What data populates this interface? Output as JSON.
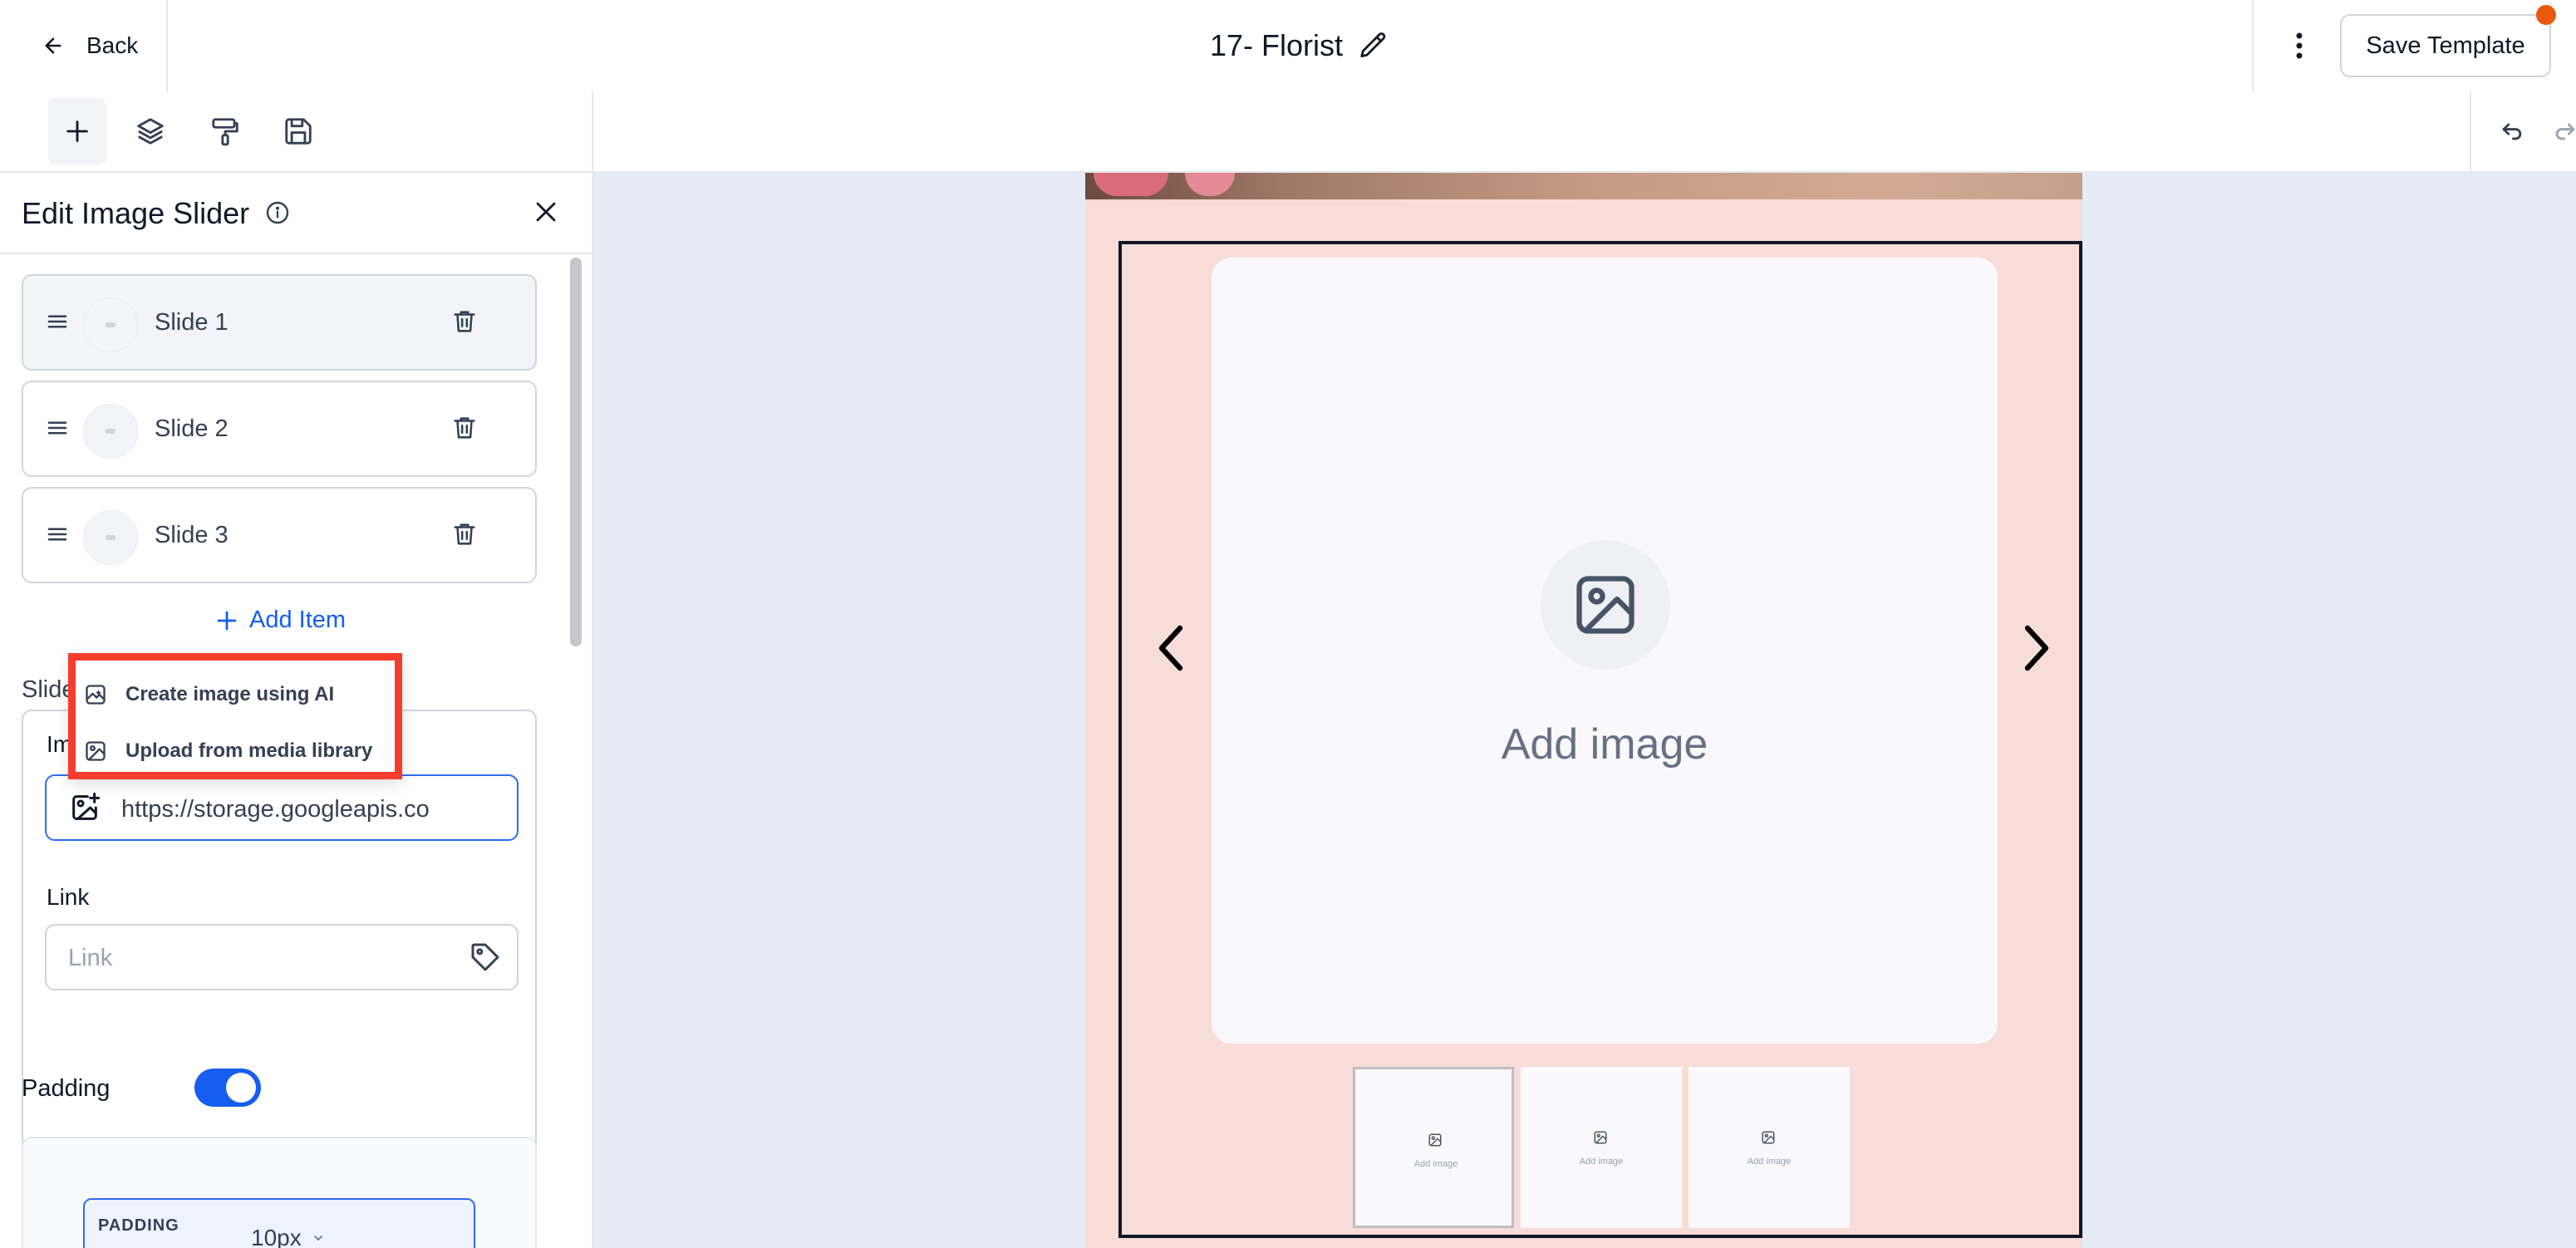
{
  "header": {
    "back_label": "Back",
    "title": "17- Florist",
    "save_label": "Save Template"
  },
  "toolbar": {
    "tools": [
      "add-icon",
      "layers-icon",
      "paint-roller-icon",
      "save-icon"
    ],
    "active_tool": "add"
  },
  "panel": {
    "title": "Edit Image Slider",
    "slides": [
      {
        "label": "Slide 1",
        "selected": true
      },
      {
        "label": "Slide 2",
        "selected": false
      },
      {
        "label": "Slide 3",
        "selected": false
      }
    ],
    "add_item_label": "Add Item",
    "slide_section_label": "Slide",
    "image_label": "Im",
    "image_url_value": "https://storage.googleapis.co",
    "link_label": "Link",
    "link_placeholder": "Link",
    "padding_label": "Padding",
    "padding_enabled": true,
    "padding_caption": "PADDING",
    "padding_value": "10px"
  },
  "dropdown": {
    "items": [
      {
        "label": "Create image using AI",
        "icon": "ai-image-icon"
      },
      {
        "label": "Upload from media library",
        "icon": "image-icon"
      }
    ]
  },
  "canvas": {
    "main_image_label": "Add image",
    "thumbnails": [
      {
        "label": "Add image",
        "selected": true
      },
      {
        "label": "Add image",
        "selected": false
      },
      {
        "label": "Add image",
        "selected": false
      }
    ]
  },
  "colors": {
    "accent": "#155eef",
    "highlight_border": "#f53d2d",
    "email_background": "#f8dcd7",
    "canvas_background": "#e6ecf5",
    "notification_dot": "#e8590c"
  }
}
